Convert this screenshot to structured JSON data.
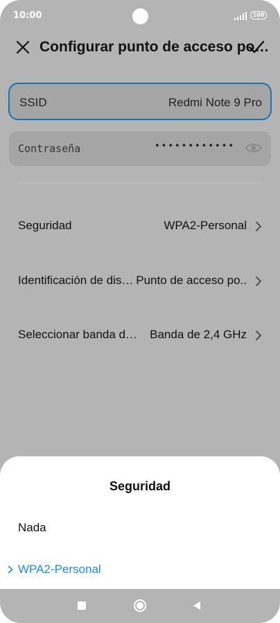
{
  "status_bar": {
    "time": "10:00",
    "battery": "100",
    "signal_icon": "signal-bars-icon",
    "camera_icon": "front-camera-icon"
  },
  "header": {
    "title": "Configurar punto de acceso po…",
    "close_icon": "close-icon",
    "confirm_icon": "checkmark-icon"
  },
  "fields": {
    "ssid_label": "SSID",
    "ssid_value": "Redmi Note 9 Pro",
    "password_label": "Contraseña",
    "password_value": "••••••••••••",
    "eye_icon": "eye-icon"
  },
  "settings": [
    {
      "label": "Seguridad",
      "value": "WPA2-Personal"
    },
    {
      "label": "Identificación de dis…",
      "value": "Punto de acceso po.."
    },
    {
      "label": "Seleccionar banda d…",
      "value": "Banda de 2,4 GHz"
    }
  ],
  "sheet": {
    "title": "Seguridad",
    "options": [
      {
        "label": "Nada",
        "selected": false
      },
      {
        "label": "WPA2-Personal",
        "selected": true
      }
    ]
  },
  "colors": {
    "accent": "#1a73b6",
    "selected_text": "#1a8fd0",
    "overlay_bg": "#b4b4b4"
  },
  "nav": {
    "recents_icon": "square-icon",
    "home_icon": "circle-icon",
    "back_icon": "triangle-back-icon"
  }
}
